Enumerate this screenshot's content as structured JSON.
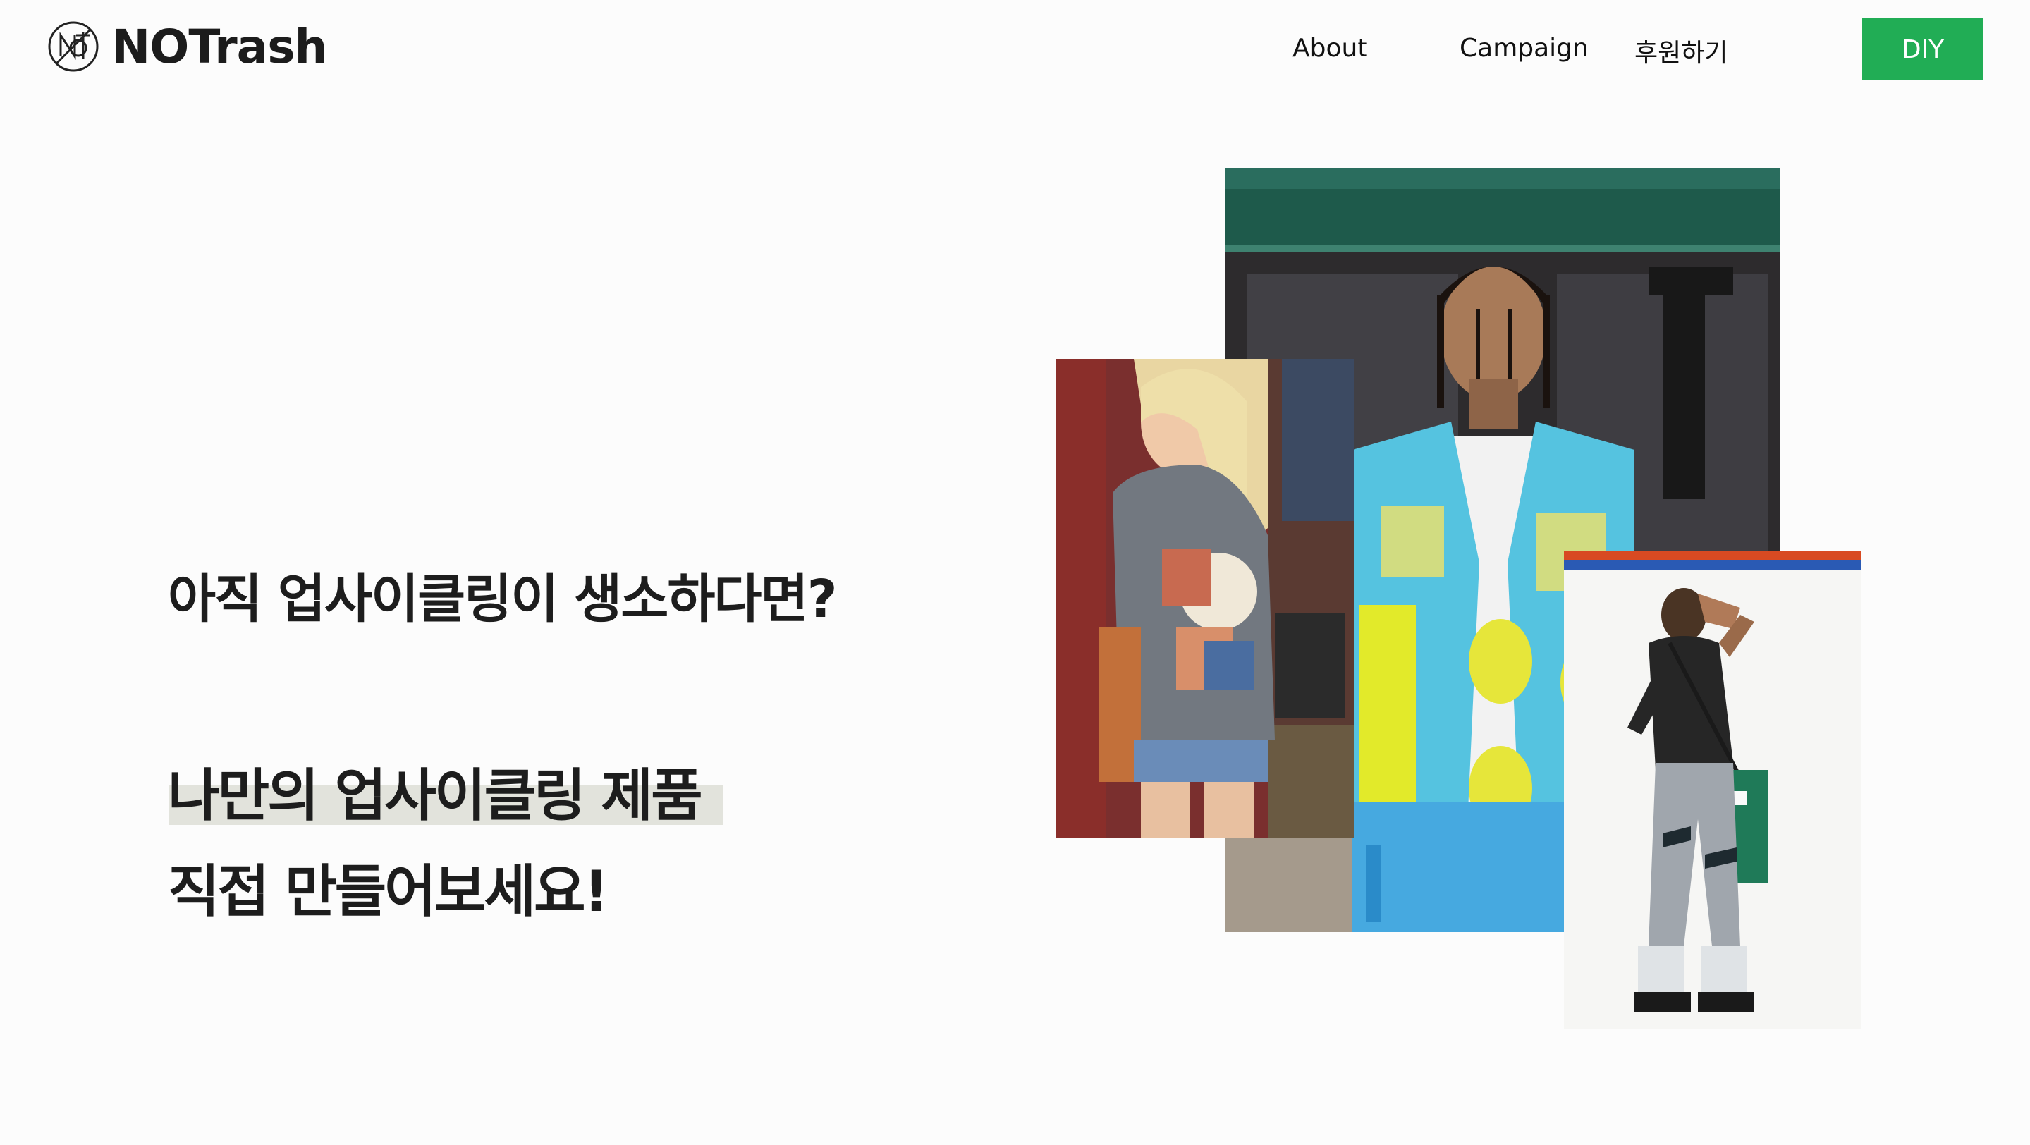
{
  "header": {
    "logo_text": "NOTrash",
    "logo_icon": "notrash-logo-icon"
  },
  "nav": {
    "about": "About",
    "campaign": "Campaign",
    "support": "후원하기",
    "diy": "DIY"
  },
  "hero": {
    "question": "아직 업사이클링이 생소하다면?",
    "line1": "나만의 업사이클링 제품",
    "line2": "직접 만들어보세요!"
  },
  "colors": {
    "accent": "#21ad55",
    "highlight": "#e2e3dc",
    "background": "#fcfcfc"
  },
  "images": {
    "main": "photo-man-upcycled-vest",
    "left": "photo-woman-patchwork-sweater",
    "right": "photo-person-upcycled-bag"
  }
}
